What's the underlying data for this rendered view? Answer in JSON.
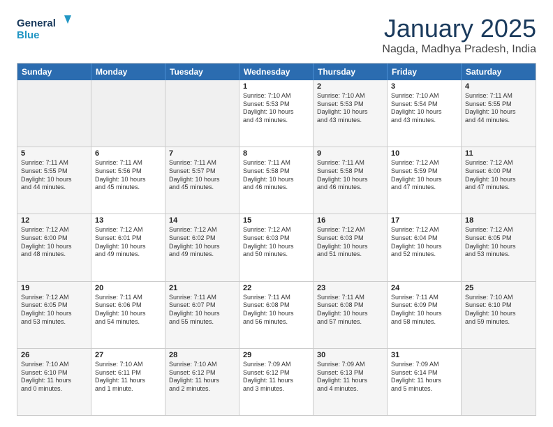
{
  "logo": {
    "line1": "General",
    "line2": "Blue"
  },
  "header": {
    "month": "January 2025",
    "location": "Nagda, Madhya Pradesh, India"
  },
  "weekdays": [
    "Sunday",
    "Monday",
    "Tuesday",
    "Wednesday",
    "Thursday",
    "Friday",
    "Saturday"
  ],
  "rows": [
    [
      {
        "day": "",
        "info": "",
        "bg": "empty"
      },
      {
        "day": "",
        "info": "",
        "bg": "empty"
      },
      {
        "day": "",
        "info": "",
        "bg": "empty"
      },
      {
        "day": "1",
        "info": "Sunrise: 7:10 AM\nSunset: 5:53 PM\nDaylight: 10 hours\nand 43 minutes.",
        "bg": ""
      },
      {
        "day": "2",
        "info": "Sunrise: 7:10 AM\nSunset: 5:53 PM\nDaylight: 10 hours\nand 43 minutes.",
        "bg": "alt-bg"
      },
      {
        "day": "3",
        "info": "Sunrise: 7:10 AM\nSunset: 5:54 PM\nDaylight: 10 hours\nand 43 minutes.",
        "bg": ""
      },
      {
        "day": "4",
        "info": "Sunrise: 7:11 AM\nSunset: 5:55 PM\nDaylight: 10 hours\nand 44 minutes.",
        "bg": "alt-bg"
      }
    ],
    [
      {
        "day": "5",
        "info": "Sunrise: 7:11 AM\nSunset: 5:55 PM\nDaylight: 10 hours\nand 44 minutes.",
        "bg": "alt-bg"
      },
      {
        "day": "6",
        "info": "Sunrise: 7:11 AM\nSunset: 5:56 PM\nDaylight: 10 hours\nand 45 minutes.",
        "bg": ""
      },
      {
        "day": "7",
        "info": "Sunrise: 7:11 AM\nSunset: 5:57 PM\nDaylight: 10 hours\nand 45 minutes.",
        "bg": "alt-bg"
      },
      {
        "day": "8",
        "info": "Sunrise: 7:11 AM\nSunset: 5:58 PM\nDaylight: 10 hours\nand 46 minutes.",
        "bg": ""
      },
      {
        "day": "9",
        "info": "Sunrise: 7:11 AM\nSunset: 5:58 PM\nDaylight: 10 hours\nand 46 minutes.",
        "bg": "alt-bg"
      },
      {
        "day": "10",
        "info": "Sunrise: 7:12 AM\nSunset: 5:59 PM\nDaylight: 10 hours\nand 47 minutes.",
        "bg": ""
      },
      {
        "day": "11",
        "info": "Sunrise: 7:12 AM\nSunset: 6:00 PM\nDaylight: 10 hours\nand 47 minutes.",
        "bg": "alt-bg"
      }
    ],
    [
      {
        "day": "12",
        "info": "Sunrise: 7:12 AM\nSunset: 6:00 PM\nDaylight: 10 hours\nand 48 minutes.",
        "bg": "alt-bg"
      },
      {
        "day": "13",
        "info": "Sunrise: 7:12 AM\nSunset: 6:01 PM\nDaylight: 10 hours\nand 49 minutes.",
        "bg": ""
      },
      {
        "day": "14",
        "info": "Sunrise: 7:12 AM\nSunset: 6:02 PM\nDaylight: 10 hours\nand 49 minutes.",
        "bg": "alt-bg"
      },
      {
        "day": "15",
        "info": "Sunrise: 7:12 AM\nSunset: 6:03 PM\nDaylight: 10 hours\nand 50 minutes.",
        "bg": ""
      },
      {
        "day": "16",
        "info": "Sunrise: 7:12 AM\nSunset: 6:03 PM\nDaylight: 10 hours\nand 51 minutes.",
        "bg": "alt-bg"
      },
      {
        "day": "17",
        "info": "Sunrise: 7:12 AM\nSunset: 6:04 PM\nDaylight: 10 hours\nand 52 minutes.",
        "bg": ""
      },
      {
        "day": "18",
        "info": "Sunrise: 7:12 AM\nSunset: 6:05 PM\nDaylight: 10 hours\nand 53 minutes.",
        "bg": "alt-bg"
      }
    ],
    [
      {
        "day": "19",
        "info": "Sunrise: 7:12 AM\nSunset: 6:05 PM\nDaylight: 10 hours\nand 53 minutes.",
        "bg": "alt-bg"
      },
      {
        "day": "20",
        "info": "Sunrise: 7:11 AM\nSunset: 6:06 PM\nDaylight: 10 hours\nand 54 minutes.",
        "bg": ""
      },
      {
        "day": "21",
        "info": "Sunrise: 7:11 AM\nSunset: 6:07 PM\nDaylight: 10 hours\nand 55 minutes.",
        "bg": "alt-bg"
      },
      {
        "day": "22",
        "info": "Sunrise: 7:11 AM\nSunset: 6:08 PM\nDaylight: 10 hours\nand 56 minutes.",
        "bg": ""
      },
      {
        "day": "23",
        "info": "Sunrise: 7:11 AM\nSunset: 6:08 PM\nDaylight: 10 hours\nand 57 minutes.",
        "bg": "alt-bg"
      },
      {
        "day": "24",
        "info": "Sunrise: 7:11 AM\nSunset: 6:09 PM\nDaylight: 10 hours\nand 58 minutes.",
        "bg": ""
      },
      {
        "day": "25",
        "info": "Sunrise: 7:10 AM\nSunset: 6:10 PM\nDaylight: 10 hours\nand 59 minutes.",
        "bg": "alt-bg"
      }
    ],
    [
      {
        "day": "26",
        "info": "Sunrise: 7:10 AM\nSunset: 6:10 PM\nDaylight: 11 hours\nand 0 minutes.",
        "bg": "alt-bg"
      },
      {
        "day": "27",
        "info": "Sunrise: 7:10 AM\nSunset: 6:11 PM\nDaylight: 11 hours\nand 1 minute.",
        "bg": ""
      },
      {
        "day": "28",
        "info": "Sunrise: 7:10 AM\nSunset: 6:12 PM\nDaylight: 11 hours\nand 2 minutes.",
        "bg": "alt-bg"
      },
      {
        "day": "29",
        "info": "Sunrise: 7:09 AM\nSunset: 6:12 PM\nDaylight: 11 hours\nand 3 minutes.",
        "bg": ""
      },
      {
        "day": "30",
        "info": "Sunrise: 7:09 AM\nSunset: 6:13 PM\nDaylight: 11 hours\nand 4 minutes.",
        "bg": "alt-bg"
      },
      {
        "day": "31",
        "info": "Sunrise: 7:09 AM\nSunset: 6:14 PM\nDaylight: 11 hours\nand 5 minutes.",
        "bg": ""
      },
      {
        "day": "",
        "info": "",
        "bg": "empty"
      }
    ]
  ]
}
